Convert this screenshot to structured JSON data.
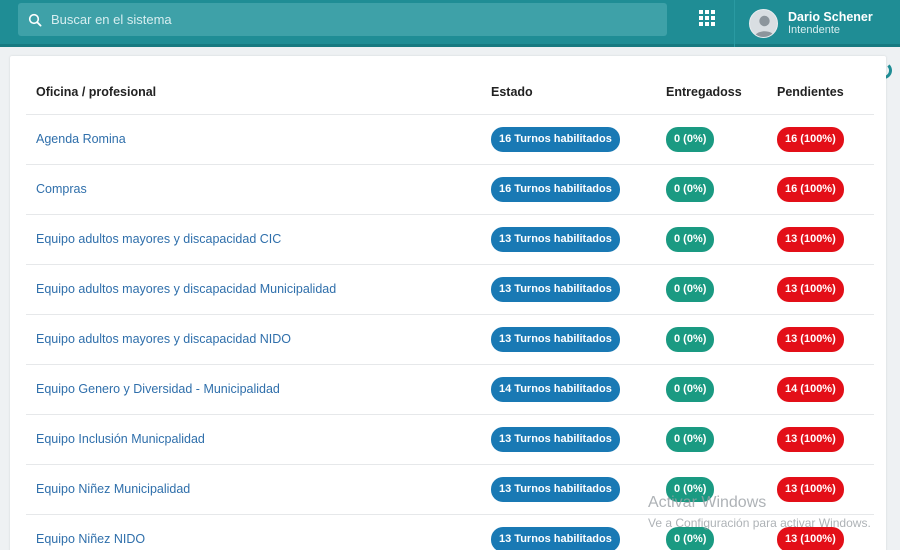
{
  "search": {
    "placeholder": "Buscar en el sistema"
  },
  "user": {
    "name": "Dario Schener",
    "role": "Intendente"
  },
  "table": {
    "headers": [
      "Oficina / profesional",
      "Estado",
      "Entregadoss",
      "Pendientes"
    ],
    "rows": [
      {
        "name": "Agenda Romina",
        "estado": "16 Turnos habilitados",
        "entregados": "0 (0%)",
        "pendientes": "16 (100%)"
      },
      {
        "name": "Compras",
        "estado": "16 Turnos habilitados",
        "entregados": "0 (0%)",
        "pendientes": "16 (100%)"
      },
      {
        "name": "Equipo adultos mayores y discapacidad CIC",
        "estado": "13 Turnos habilitados",
        "entregados": "0 (0%)",
        "pendientes": "13 (100%)"
      },
      {
        "name": "Equipo adultos mayores y discapacidad Municipalidad",
        "estado": "13 Turnos habilitados",
        "entregados": "0 (0%)",
        "pendientes": "13 (100%)"
      },
      {
        "name": "Equipo adultos mayores y discapacidad NIDO",
        "estado": "13 Turnos habilitados",
        "entregados": "0 (0%)",
        "pendientes": "13 (100%)"
      },
      {
        "name": "Equipo Genero y Diversidad - Municipalidad",
        "estado": "14 Turnos habilitados",
        "entregados": "0 (0%)",
        "pendientes": "14 (100%)"
      },
      {
        "name": "Equipo Inclusión Municpalidad",
        "estado": "13 Turnos habilitados",
        "entregados": "0 (0%)",
        "pendientes": "13 (100%)"
      },
      {
        "name": "Equipo Niñez Municipalidad",
        "estado": "13 Turnos habilitados",
        "entregados": "0 (0%)",
        "pendientes": "13 (100%)"
      },
      {
        "name": "Equipo Niñez NIDO",
        "estado": "13 Turnos habilitados",
        "entregados": "0 (0%)",
        "pendientes": "13 (100%)"
      }
    ]
  },
  "watermark": {
    "title": "Activar Windows",
    "subtitle": "Ve a Configuración para activar Windows."
  },
  "colors": {
    "topbar": "#1f8d95",
    "estado_badge": "#1979b4",
    "entregados_badge": "#1a9a82",
    "pendientes_badge": "#e30f18",
    "link": "#2f6fab"
  },
  "icons": {
    "search": "search-icon",
    "apps": "apps-grid-icon",
    "avatar": "user-avatar-icon",
    "loading": "loading-spinner-icon"
  }
}
